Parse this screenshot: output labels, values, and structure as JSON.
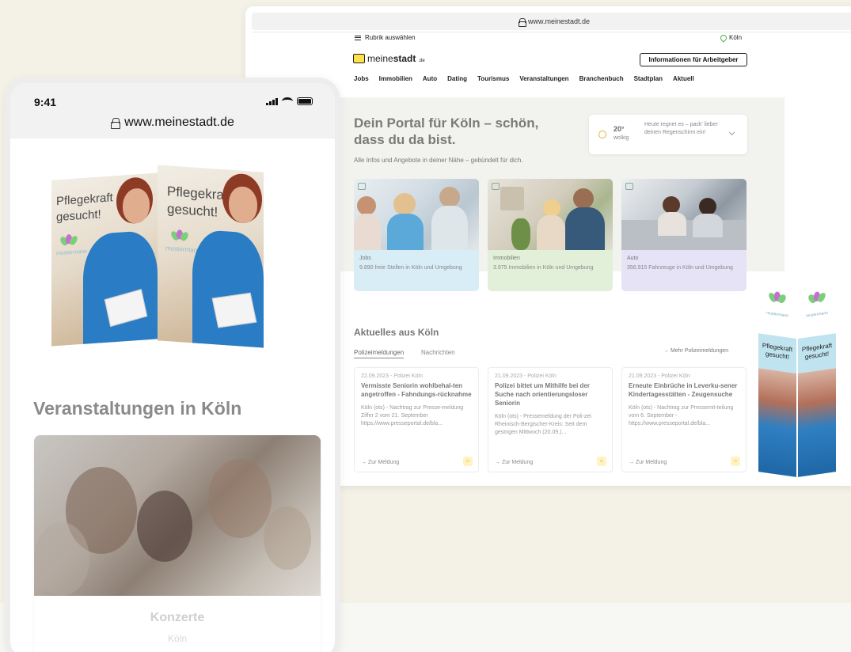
{
  "desktop": {
    "url": "www.meinestadt.de",
    "rubrik_label": "Rubrik auswählen",
    "city": "Köln",
    "logo": {
      "part1": "meine",
      "part2": "stadt",
      "part3": ".de"
    },
    "employer_button": "Informationen für Arbeitgeber",
    "nav": [
      "Jobs",
      "Immobilien",
      "Auto",
      "Dating",
      "Tourismus",
      "Veranstaltungen",
      "Branchenbuch",
      "Stadtplan",
      "Aktuell"
    ],
    "hero": {
      "headline": "Dein Portal für Köln – schön, dass du da bist.",
      "subline": "Alle Infos und Angebote in deiner Nähe – gebündelt für dich."
    },
    "weather": {
      "temp": "20°",
      "condition": "wolkig",
      "text": "Heute regnet es – pack' lieber deinen Regenschirm ein!"
    },
    "cards": [
      {
        "title": "Jobs",
        "desc": "9.890 freie Stellen in Köln und Umgebung",
        "color": "#d9edf7"
      },
      {
        "title": "Immobilien",
        "desc": "3.975 Immobilien in Köln und Umgebung",
        "color": "#e3f0d9"
      },
      {
        "title": "Auto",
        "desc": "356.915 Fahrzeuge in Köln und Umgebung",
        "color": "#e6e3f7"
      }
    ],
    "news": {
      "title": "Aktuelles aus Köln",
      "tabs": [
        "Polizeimeldungen",
        "Nachrichten"
      ],
      "more": "→ Mehr Polizeimeldungen",
      "items": [
        {
          "date": "22.09.2023 - Polizei Köln",
          "head": "Vermisste Seniorin wohlbehal-ten angetroffen - Fahndungs-rücknahme",
          "text": "Köln (ots) - Nachtrag zur Presse-meldung Ziffer 2 vom 21. September https://www.presseportal.de/bla...",
          "link": "→ Zur Meldung"
        },
        {
          "date": "21.09.2023 - Polizei Köln",
          "head": "Polizei bittet um Mithilfe bei der Suche nach orientierungsloser Seniorin",
          "text": "Köln (ots) - Pressemeldung der Poli-zei Rheinisch-Bergischer-Kreis: Seit dem gestrigen Mittwoch (20.09.)...",
          "link": "→ Zur Meldung"
        },
        {
          "date": "21.09.2023 - Polizei Köln",
          "head": "Erneute Einbrüche in Leverku-sener Kindertagesstätten - Zeugensuche",
          "text": "Köln (ots) - Nachtrag zur Pressemit-teilung vom 6. September - https://www.presseportal.de/bla...",
          "link": "→ Zur Meldung"
        }
      ]
    },
    "ad": {
      "brand": "mustermann",
      "text": "Pflegekraft gesucht!"
    }
  },
  "mobile": {
    "time": "9:41",
    "url": "www.meinestadt.de",
    "ad": {
      "text_left": "Pflegekraft gesucht!",
      "text_right": "Pflegekraft gesucht!",
      "brand": "mustermann"
    },
    "section_title": "Veranstaltungen in Köln",
    "event": {
      "title": "Konzerte",
      "subtitle": "Köln"
    }
  },
  "colors": {
    "background": "#f4f1e7",
    "logo_yellow": "#ffe14a",
    "ad_blue": "#bfe3ef",
    "scrubs": "#2a7dc4"
  }
}
